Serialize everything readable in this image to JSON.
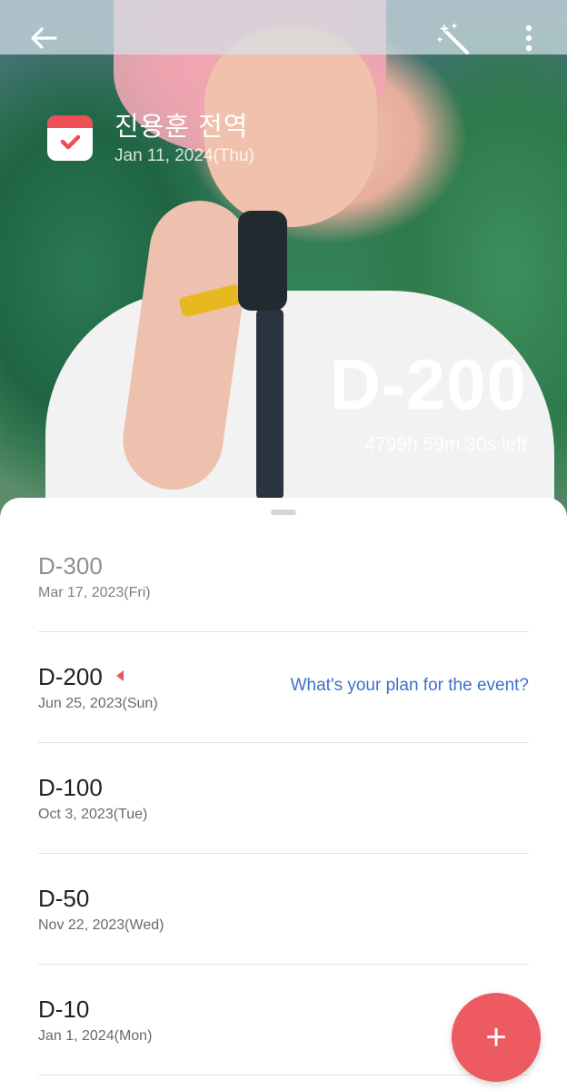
{
  "header": {
    "back_icon": "arrow-left-icon",
    "magic_icon": "magic-wand-icon",
    "more_icon": "more-vertical-icon"
  },
  "event": {
    "icon": "calendar-check-icon",
    "title": "진용훈 전역",
    "date": "Jan 11, 2024(Thu)",
    "countdown": "D-200",
    "time_left": "4799h 59m 30s left"
  },
  "milestones": [
    {
      "label": "D-300",
      "date": "Mar 17, 2023(Fri)",
      "past": true
    },
    {
      "label": "D-200",
      "date": "Jun 25, 2023(Sun)",
      "current": true,
      "prompt": "What's your plan for the event?"
    },
    {
      "label": "D-100",
      "date": "Oct 3, 2023(Tue)"
    },
    {
      "label": "D-50",
      "date": "Nov 22, 2023(Wed)"
    },
    {
      "label": "D-10",
      "date": "Jan 1, 2024(Mon)"
    }
  ],
  "fab": {
    "label": "+",
    "icon": "plus-icon"
  },
  "colors": {
    "accent": "#ee5a62",
    "link": "#3f6fc9",
    "divider": "#dfe3e6"
  }
}
